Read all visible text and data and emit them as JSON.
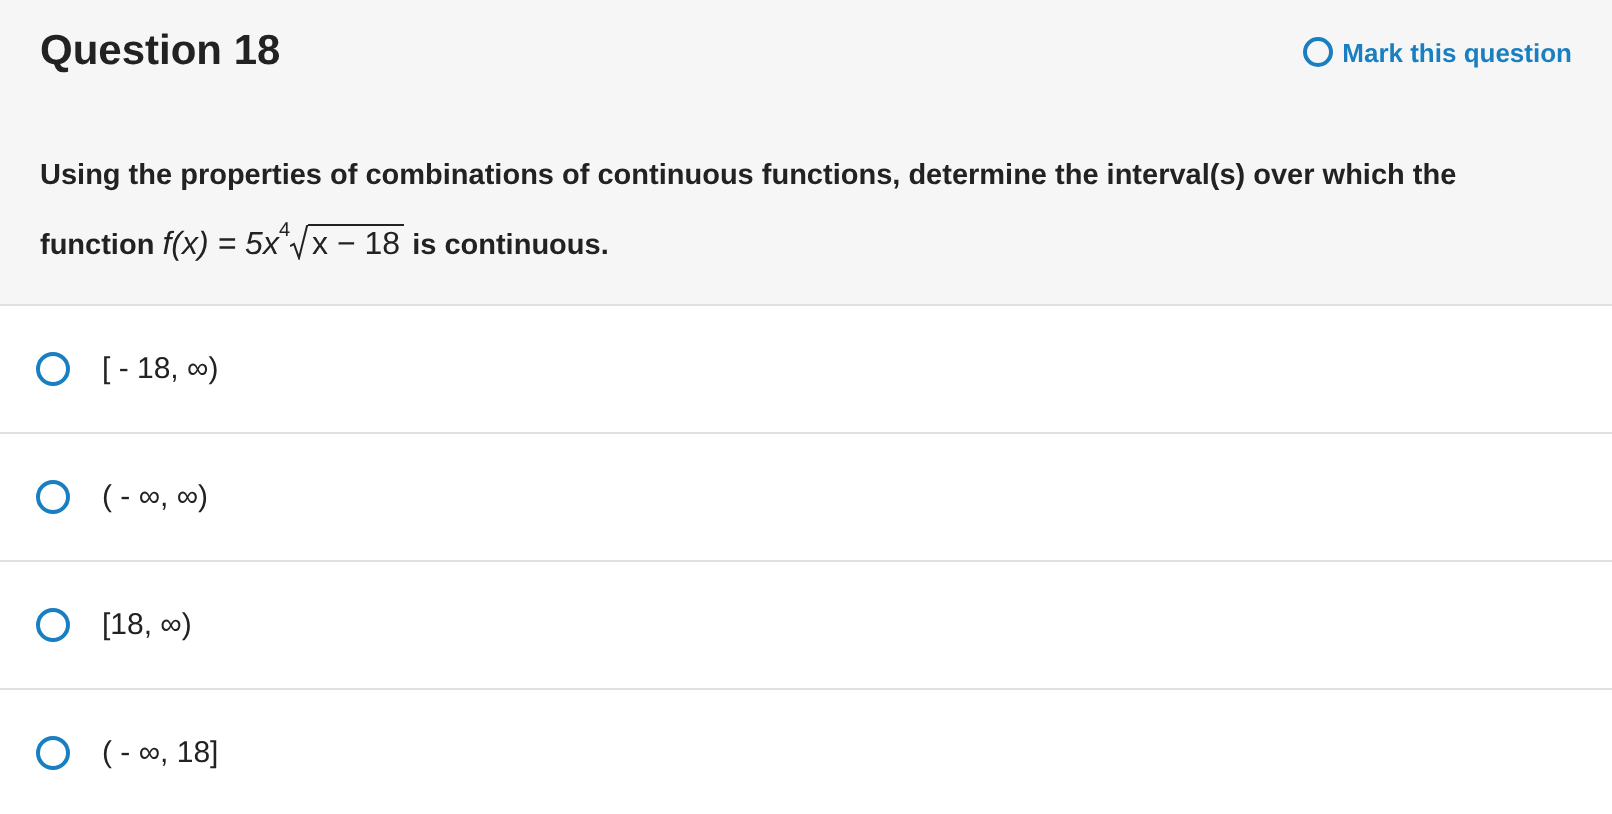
{
  "question": {
    "title": "Question 18",
    "mark_link": "Mark this question",
    "prompt_before": "Using the properties of combinations of continuous functions, determine the interval(s) over which the function",
    "formula": {
      "lhs": "f(x) = 5x",
      "root_index": "4",
      "radicand": "x − 18"
    },
    "prompt_after": "is continuous."
  },
  "options": [
    {
      "label": "[ - 18, ∞)",
      "selected": false
    },
    {
      "label": "( - ∞, ∞)",
      "selected": false
    },
    {
      "label": "[18, ∞)",
      "selected": false
    },
    {
      "label": "( - ∞, 18]",
      "selected": false
    }
  ]
}
